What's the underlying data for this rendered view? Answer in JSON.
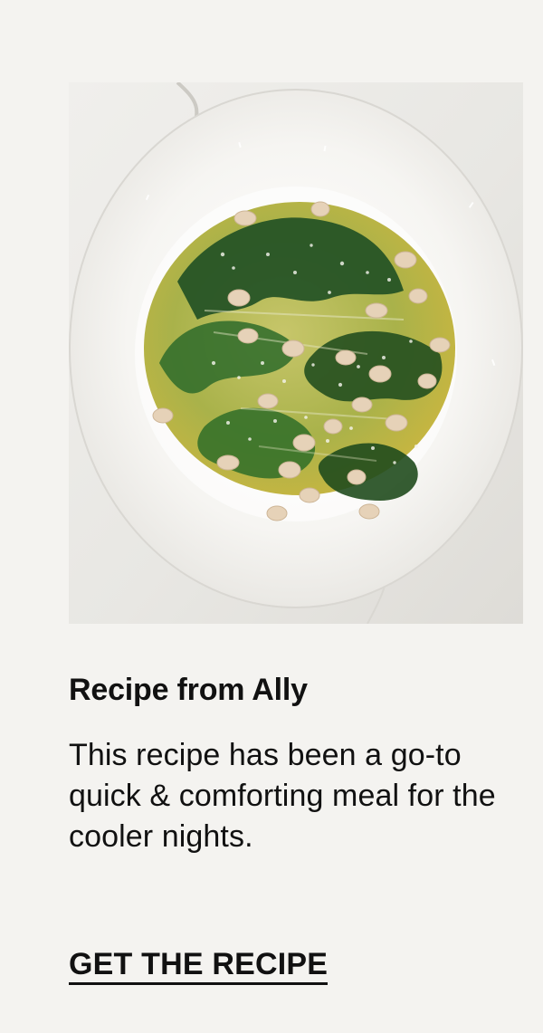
{
  "recipe_card": {
    "image_alt": "Bowl of white beans with greens and grated cheese",
    "heading": "Recipe from Ally",
    "description": "This recipe has been a go-to quick & comforting meal for the cooler nights.",
    "cta_label": "GET THE RECIPE"
  }
}
